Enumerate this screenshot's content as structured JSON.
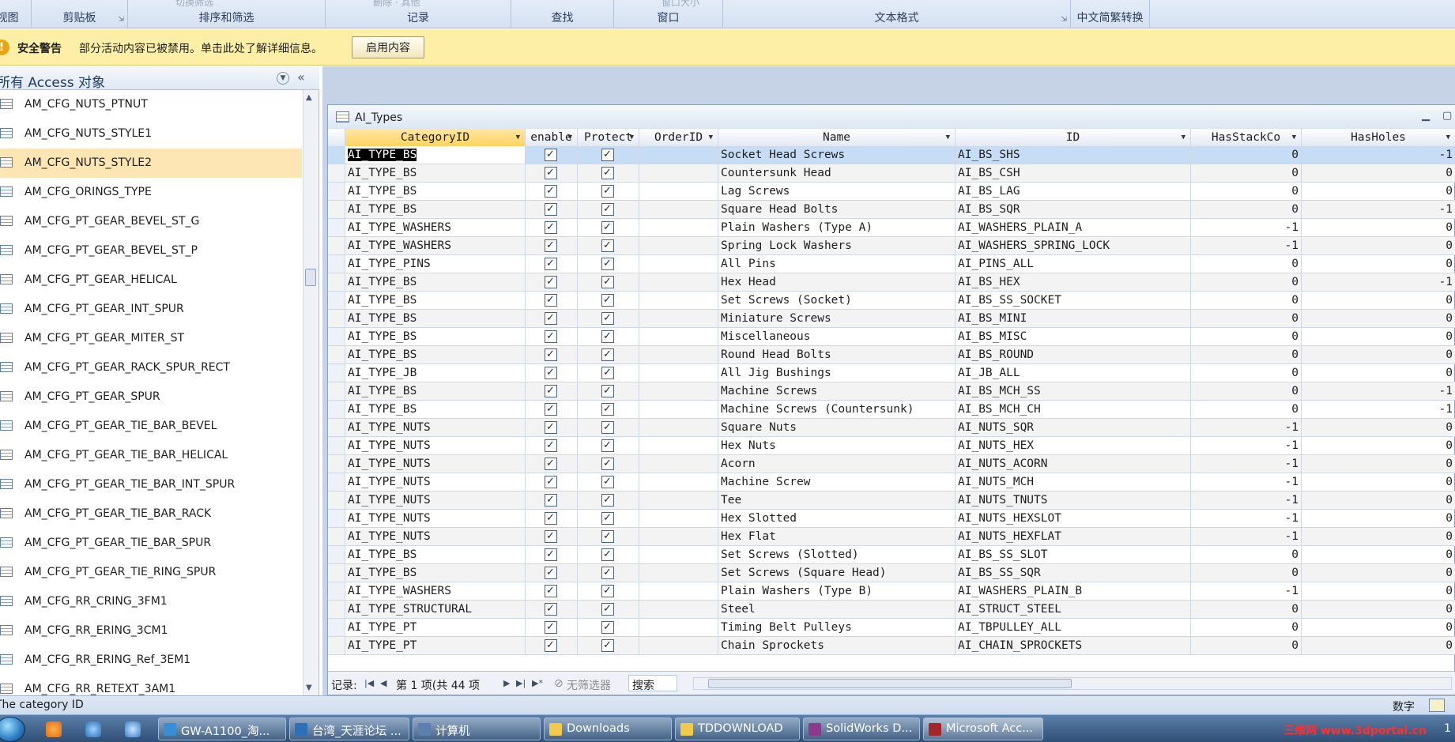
{
  "ribbon": {
    "groups": [
      {
        "label": "视图",
        "launcher": false,
        "ghost": ""
      },
      {
        "label": "剪贴板",
        "launcher": true,
        "ghost": ""
      },
      {
        "label": "排序和筛选",
        "launcher": false,
        "ghost": "切换筛选"
      },
      {
        "label": "记录",
        "launcher": false,
        "ghost": "删除 · 其他"
      },
      {
        "label": "查找",
        "launcher": false,
        "ghost": ""
      },
      {
        "label": "窗口",
        "launcher": false,
        "ghost": "窗口大小"
      },
      {
        "label": "文本格式",
        "launcher": true,
        "ghost": ""
      },
      {
        "label": "中文简繁转换",
        "launcher": false,
        "ghost": ""
      }
    ]
  },
  "security": {
    "icon": "warning-icon",
    "title": "安全警告",
    "message": "部分活动内容已被禁用。单击此处了解详细信息。",
    "enable_label": "启用内容"
  },
  "nav": {
    "title": "所有 Access 对象",
    "collapse_glyph": "«",
    "selected_index": 2,
    "items": [
      "AM_CFG_NUTS_PTNUT",
      "AM_CFG_NUTS_STYLE1",
      "AM_CFG_NUTS_STYLE2",
      "AM_CFG_ORINGS_TYPE",
      "AM_CFG_PT_GEAR_BEVEL_ST_G",
      "AM_CFG_PT_GEAR_BEVEL_ST_P",
      "AM_CFG_PT_GEAR_HELICAL",
      "AM_CFG_PT_GEAR_INT_SPUR",
      "AM_CFG_PT_GEAR_MITER_ST",
      "AM_CFG_PT_GEAR_RACK_SPUR_RECT",
      "AM_CFG_PT_GEAR_SPUR",
      "AM_CFG_PT_GEAR_TIE_BAR_BEVEL",
      "AM_CFG_PT_GEAR_TIE_BAR_HELICAL",
      "AM_CFG_PT_GEAR_TIE_BAR_INT_SPUR",
      "AM_CFG_PT_GEAR_TIE_BAR_RACK",
      "AM_CFG_PT_GEAR_TIE_BAR_SPUR",
      "AM_CFG_PT_GEAR_TIE_RING_SPUR",
      "AM_CFG_RR_CRING_3FM1",
      "AM_CFG_RR_ERING_3CM1",
      "AM_CFG_RR_ERING_Ref_3EM1",
      "AM_CFG_RR_RETEXT_3AM1"
    ]
  },
  "table": {
    "title": "AI_Types",
    "columns": [
      "CategoryID",
      "enable",
      "Protect",
      "OrderID",
      "Name",
      "ID",
      "HasStackCo",
      "HasHoles"
    ],
    "rows": [
      [
        "AI_TYPE_BS",
        true,
        true,
        "",
        "Socket Head Screws",
        "AI_BS_SHS",
        "0",
        "-1"
      ],
      [
        "AI_TYPE_BS",
        true,
        true,
        "",
        "Countersunk Head",
        "AI_BS_CSH",
        "0",
        "0"
      ],
      [
        "AI_TYPE_BS",
        true,
        true,
        "",
        "Lag Screws",
        "AI_BS_LAG",
        "0",
        "0"
      ],
      [
        "AI_TYPE_BS",
        true,
        true,
        "",
        "Square Head Bolts",
        "AI_BS_SQR",
        "0",
        "-1"
      ],
      [
        "AI_TYPE_WASHERS",
        true,
        true,
        "",
        "Plain Washers (Type A)",
        "AI_WASHERS_PLAIN_A",
        "-1",
        "0"
      ],
      [
        "AI_TYPE_WASHERS",
        true,
        true,
        "",
        "Spring Lock Washers",
        "AI_WASHERS_SPRING_LOCK",
        "-1",
        "0"
      ],
      [
        "AI_TYPE_PINS",
        true,
        true,
        "",
        "All Pins",
        "AI_PINS_ALL",
        "0",
        "0"
      ],
      [
        "AI_TYPE_BS",
        true,
        true,
        "",
        "Hex Head",
        "AI_BS_HEX",
        "0",
        "-1"
      ],
      [
        "AI_TYPE_BS",
        true,
        true,
        "",
        "Set Screws (Socket)",
        "AI_BS_SS_SOCKET",
        "0",
        "0"
      ],
      [
        "AI_TYPE_BS",
        true,
        true,
        "",
        "Miniature Screws",
        "AI_BS_MINI",
        "0",
        "0"
      ],
      [
        "AI_TYPE_BS",
        true,
        true,
        "",
        "Miscellaneous",
        "AI_BS_MISC",
        "0",
        "0"
      ],
      [
        "AI_TYPE_BS",
        true,
        true,
        "",
        "Round Head Bolts",
        "AI_BS_ROUND",
        "0",
        "0"
      ],
      [
        "AI_TYPE_JB",
        true,
        true,
        "",
        "All Jig Bushings",
        "AI_JB_ALL",
        "0",
        "0"
      ],
      [
        "AI_TYPE_BS",
        true,
        true,
        "",
        "Machine Screws",
        "AI_BS_MCH_SS",
        "0",
        "-1"
      ],
      [
        "AI_TYPE_BS",
        true,
        true,
        "",
        "Machine Screws (Countersunk)",
        "AI_BS_MCH_CH",
        "0",
        "-1"
      ],
      [
        "AI_TYPE_NUTS",
        true,
        true,
        "",
        "Square Nuts",
        "AI_NUTS_SQR",
        "-1",
        "0"
      ],
      [
        "AI_TYPE_NUTS",
        true,
        true,
        "",
        "Hex Nuts",
        "AI_NUTS_HEX",
        "-1",
        "0"
      ],
      [
        "AI_TYPE_NUTS",
        true,
        true,
        "",
        "Acorn",
        "AI_NUTS_ACORN",
        "-1",
        "0"
      ],
      [
        "AI_TYPE_NUTS",
        true,
        true,
        "",
        "Machine Screw",
        "AI_NUTS_MCH",
        "-1",
        "0"
      ],
      [
        "AI_TYPE_NUTS",
        true,
        true,
        "",
        "Tee",
        "AI_NUTS_TNUTS",
        "-1",
        "0"
      ],
      [
        "AI_TYPE_NUTS",
        true,
        true,
        "",
        "Hex Slotted",
        "AI_NUTS_HEXSLOT",
        "-1",
        "0"
      ],
      [
        "AI_TYPE_NUTS",
        true,
        true,
        "",
        "Hex Flat",
        "AI_NUTS_HEXFLAT",
        "-1",
        "0"
      ],
      [
        "AI_TYPE_BS",
        true,
        true,
        "",
        "Set Screws (Slotted)",
        "AI_BS_SS_SLOT",
        "0",
        "0"
      ],
      [
        "AI_TYPE_BS",
        true,
        true,
        "",
        "Set Screws (Square Head)",
        "AI_BS_SS_SQR",
        "0",
        "0"
      ],
      [
        "AI_TYPE_WASHERS",
        true,
        true,
        "",
        "Plain Washers (Type B)",
        "AI_WASHERS_PLAIN_B",
        "-1",
        "0"
      ],
      [
        "AI_TYPE_STRUCTURAL",
        true,
        true,
        "",
        "Steel",
        "AI_STRUCT_STEEL",
        "0",
        "0"
      ],
      [
        "AI_TYPE_PT",
        true,
        true,
        "",
        "Timing Belt Pulleys",
        "AI_TBPULLEY_ALL",
        "0",
        "0"
      ],
      [
        "AI_TYPE_PT",
        true,
        true,
        "",
        "Chain Sprockets",
        "AI_CHAIN_SPROCKETS",
        "0",
        "0"
      ]
    ]
  },
  "record_nav": {
    "label": "记录:",
    "position": "第 1 项(共 44 项",
    "filter": "无筛选器",
    "search": "搜索"
  },
  "status": {
    "left": "The category ID",
    "right": "数字"
  },
  "taskbar": {
    "tasks": [
      {
        "label": "GW-A1100_淘...",
        "icon": "ie-icon",
        "color": "#3a8ed8"
      },
      {
        "label": "台湾_天涯论坛 ...",
        "icon": "browser-icon",
        "color": "#2d6fb8"
      },
      {
        "label": "计算机",
        "icon": "computer-icon",
        "color": "#5d7fb0"
      },
      {
        "label": "Downloads",
        "icon": "folder-icon",
        "color": "#f1c94b"
      },
      {
        "label": "TDDOWNLOAD",
        "icon": "folder-icon",
        "color": "#f1c94b"
      },
      {
        "label": "SolidWorks D...",
        "icon": "archive-icon",
        "color": "#8c3a8c"
      },
      {
        "label": "Microsoft Acc...",
        "icon": "access-icon",
        "color": "#a4262c"
      }
    ],
    "watermark": "三维网 www.3dportal.cn",
    "clock": "1"
  }
}
